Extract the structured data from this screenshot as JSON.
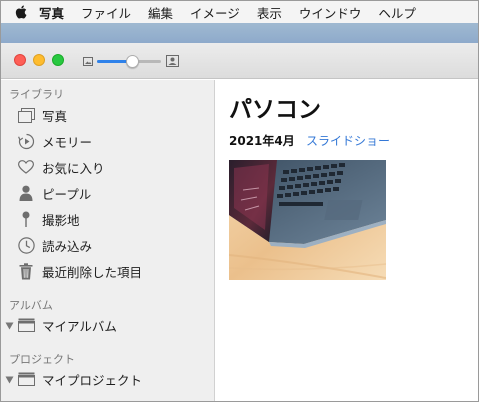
{
  "menubar": {
    "apple_icon": "apple-logo-icon",
    "items": [
      "写真",
      "ファイル",
      "編集",
      "イメージ",
      "表示",
      "ウインドウ",
      "ヘルプ"
    ]
  },
  "toolbar": {
    "zoom_level": 0.55,
    "zoom_small_icon": "small-photo-icon",
    "zoom_large_icon": "large-photo-icon"
  },
  "sidebar": {
    "library_title": "ライブラリ",
    "library_items": [
      {
        "label": "写真",
        "icon": "photos-icon"
      },
      {
        "label": "メモリー",
        "icon": "memories-icon"
      },
      {
        "label": "お気に入り",
        "icon": "heart-icon"
      },
      {
        "label": "ピープル",
        "icon": "person-icon"
      },
      {
        "label": "撮影地",
        "icon": "pin-icon"
      },
      {
        "label": "読み込み",
        "icon": "clock-icon"
      },
      {
        "label": "最近削除した項目",
        "icon": "trash-icon"
      }
    ],
    "albums_title": "アルバム",
    "albums_item": {
      "label": "マイアルバム",
      "icon": "folder-icon"
    },
    "projects_title": "プロジェクト",
    "projects_item": {
      "label": "マイプロジェクト",
      "icon": "folder-icon"
    }
  },
  "main": {
    "title": "パソコン",
    "date": "2021年4月",
    "slideshow": "スライドショー",
    "photo_icon": "laptop-photo-thumbnail"
  },
  "colors": {
    "accent": "#3478d6",
    "slider_fill": "#2f82ea",
    "sidebar_bg": "#efefef"
  }
}
